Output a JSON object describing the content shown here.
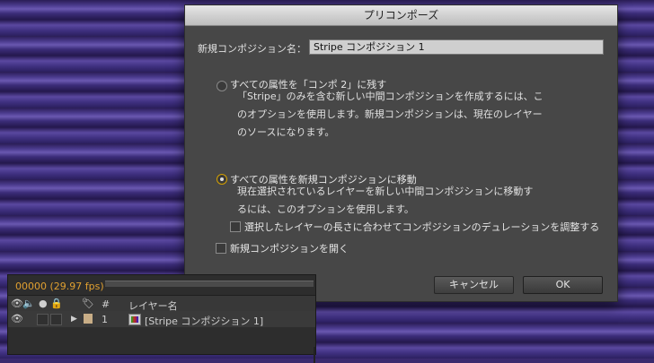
{
  "dialog": {
    "title": "プリコンポーズ",
    "name_label": "新規コンポジション名：",
    "name_value": "Stripe コンポジション 1",
    "option1": {
      "label": "すべての属性を「コンポ 2」に残す",
      "desc_line1": "「Stripe」のみを含む新しい中間コンポジションを作成するには、こ",
      "desc_line2": "のオプションを使用します。新規コンポジションは、現在のレイヤー",
      "desc_line3": "のソースになります。",
      "selected": false
    },
    "option2": {
      "label": "すべての属性を新規コンポジションに移動",
      "desc_line1": "現在選択されているレイヤーを新しい中間コンポジションに移動す",
      "desc_line2": "るには、このオプションを使用します。",
      "selected": true
    },
    "check_duration": "選択したレイヤーの長さに合わせてコンポジションのデュレーションを調整する",
    "check_open": "新規コンポジションを開く",
    "cancel_label": "キャンセル",
    "ok_label": "OK"
  },
  "timeline": {
    "timecode": "00000 (29.97 fps)",
    "col_number": "#",
    "col_layer_name": "レイヤー名",
    "layer": {
      "number": "1",
      "name": "[Stripe コンポジション 1]",
      "label_color": "#c8ad86"
    }
  },
  "colors": {
    "accent_radio": "#d4a000",
    "timecode": "#e0a030"
  }
}
